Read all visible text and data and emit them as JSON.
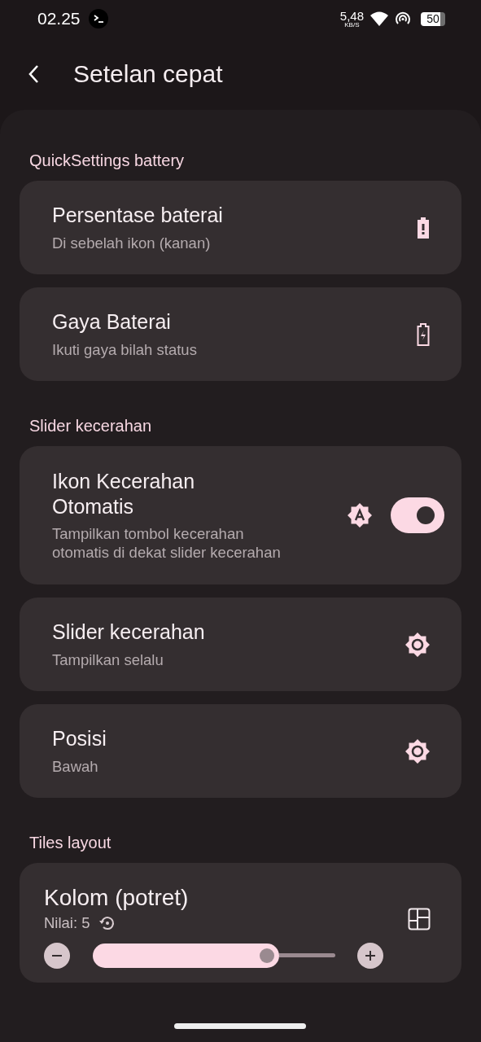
{
  "status_bar": {
    "time": "02.25",
    "speed": "5,48",
    "speed_unit": "KB/S",
    "battery": "50"
  },
  "header": {
    "title": "Setelan cepat"
  },
  "sections": [
    {
      "title": "QuickSettings battery",
      "items": [
        {
          "kind": "value",
          "title": "Persentase baterai",
          "summary": "Di sebelah ikon (kanan)"
        },
        {
          "kind": "value",
          "title": "Gaya Baterai",
          "summary": "Ikuti gaya bilah status"
        }
      ]
    },
    {
      "title": "Slider kecerahan",
      "items": [
        {
          "kind": "switch",
          "title": "Ikon Kecerahan Otomatis",
          "summary": "Tampilkan tombol kecerahan otomatis di dekat slider kecerahan",
          "on": true
        },
        {
          "kind": "value",
          "title": "Slider kecerahan",
          "summary": "Tampilkan selalu"
        },
        {
          "kind": "value",
          "title": "Posisi",
          "summary": "Bawah"
        }
      ]
    },
    {
      "title": "Tiles layout",
      "items": [
        {
          "kind": "slider",
          "title": "Kolom (potret)",
          "value_label": "Nilai: 5"
        }
      ]
    }
  ]
}
